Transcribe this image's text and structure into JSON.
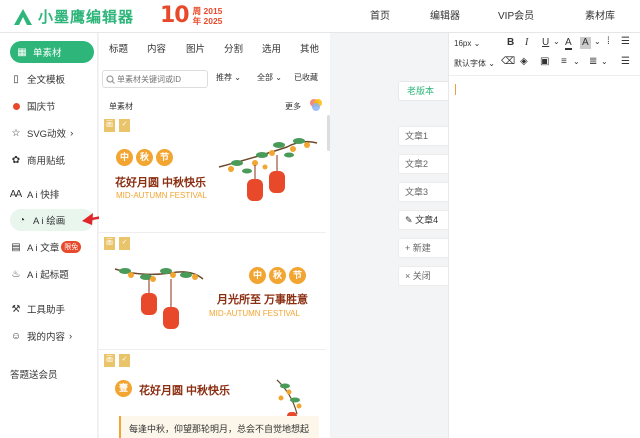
{
  "header": {
    "logo_text": "小墨鹰编辑器",
    "anniversary_number": "10",
    "anniversary_line1": "周 2015",
    "anniversary_line2": "年 2025",
    "nav": [
      {
        "label": "首页"
      },
      {
        "label": "编辑器"
      },
      {
        "label": "VIP会员"
      },
      {
        "label": "素材库"
      }
    ]
  },
  "sidebar": {
    "items": [
      {
        "label": "单素材",
        "icon": "material-icon"
      },
      {
        "label": "全文模板",
        "icon": "template-icon"
      },
      {
        "label": "国庆节",
        "icon": "dot-icon"
      },
      {
        "label": "SVG动效",
        "icon": "star-icon",
        "chevron": "›"
      },
      {
        "label": "商用贴纸",
        "icon": "sticker-icon"
      },
      {
        "label": "A i 快排",
        "icon": "ai-layout-icon"
      },
      {
        "label": "A i 绘画",
        "icon": "palette-icon"
      },
      {
        "label": "A i 文章",
        "icon": "article-icon",
        "badge": "限免"
      },
      {
        "label": "A i 起标题",
        "icon": "title-icon"
      },
      {
        "label": "工具助手",
        "icon": "tools-icon"
      },
      {
        "label": "我的内容",
        "icon": "user-icon",
        "chevron": "›"
      },
      {
        "label": "答题送会员",
        "icon": ""
      }
    ]
  },
  "panel": {
    "tabs": [
      "标题",
      "内容",
      "图片",
      "分割",
      "选用",
      "其他"
    ],
    "search_placeholder": "单素材关键词或ID",
    "filters": [
      "推荐",
      "全部",
      "已收藏"
    ],
    "list_title": "单素材",
    "more_label": "更多",
    "cards": [
      {
        "ribbon1": "画",
        "ribbon2": "",
        "badge_chars": [
          "中",
          "秋",
          "节"
        ],
        "title": "花好月圆 中秋快乐",
        "subtitle": "MID-AUTUMN FESTIVAL"
      },
      {
        "ribbon1": "画",
        "ribbon2": "",
        "badge_chars": [
          "中",
          "秋",
          "节"
        ],
        "title": "月光所至 万事胜意",
        "subtitle": "MID-AUTUMN FESTIVAL"
      },
      {
        "ribbon1": "画",
        "ribbon2": "",
        "number_badge": "壹",
        "title": "花好月圆 中秋快乐",
        "body": "每逢中秋，仰望那轮明月，总会不自觉地想起"
      }
    ]
  },
  "canvas": {
    "version_label": "老版本",
    "docs": [
      "文章1",
      "文章2",
      "文章3",
      "文章4"
    ],
    "new_label": "新建",
    "close_label": "关闭"
  },
  "editor": {
    "font_size": "16px",
    "font_family": "默认字体"
  },
  "colors": {
    "brand": "#2eb67a",
    "accent_red": "#e8492a",
    "festival_orange": "#f2a531",
    "ribbon_gold": "#e9c46a"
  }
}
